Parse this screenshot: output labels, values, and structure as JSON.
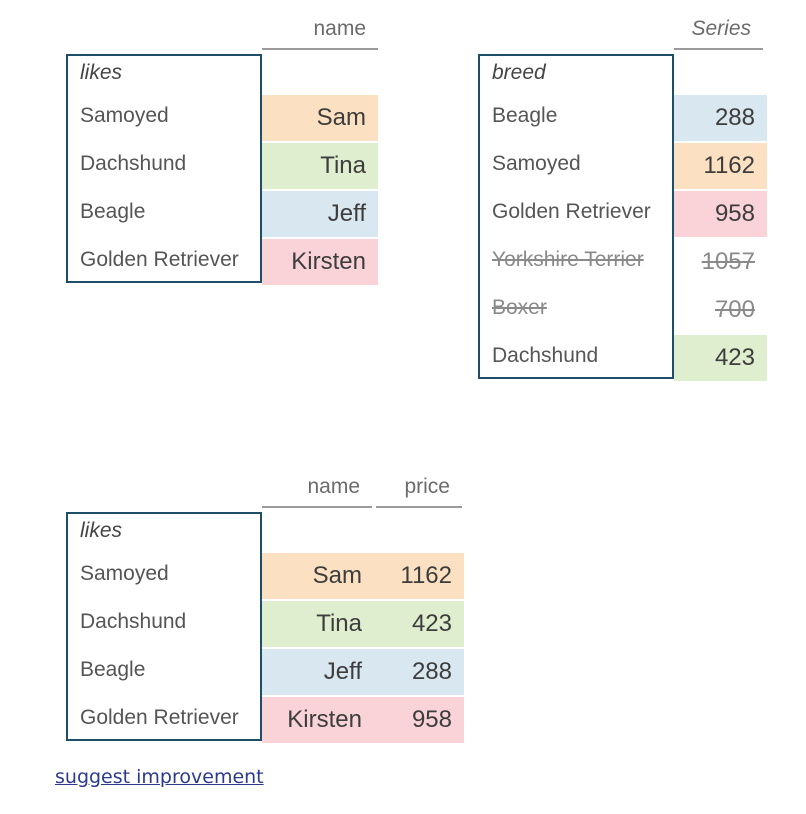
{
  "page": {
    "background": "#ffffff",
    "index_box_border_color": "#1f4e69",
    "header_rule_color": "#9a9a9a",
    "text_color": "#555555",
    "muted_text_color": "#8a8a8a",
    "link_color": "#2b3a8f"
  },
  "palette": {
    "orange": "#fce0c2",
    "green": "#dfeecf",
    "blue": "#d8e7f0",
    "pink": "#f9d3d8",
    "none": "#ffffff"
  },
  "left_table": {
    "name": "likes-dataframe",
    "index_header": "likes",
    "columns": [
      "name"
    ],
    "rows": [
      {
        "index": "Samoyed",
        "name": "Sam",
        "color": "orange",
        "struck": false
      },
      {
        "index": "Dachshund",
        "name": "Tina",
        "color": "green",
        "struck": false
      },
      {
        "index": "Beagle",
        "name": "Jeff",
        "color": "blue",
        "struck": false
      },
      {
        "index": "Golden Retriever",
        "name": "Kirsten",
        "color": "pink",
        "struck": false
      }
    ]
  },
  "right_table": {
    "name": "breed-series",
    "index_header": "breed",
    "series_header": "Series",
    "columns": [
      "Series"
    ],
    "rows": [
      {
        "index": "Beagle",
        "value": "288",
        "color": "blue",
        "struck": false
      },
      {
        "index": "Samoyed",
        "value": "1162",
        "color": "orange",
        "struck": false
      },
      {
        "index": "Golden Retriever",
        "value": "958",
        "color": "pink",
        "struck": false
      },
      {
        "index": "Yorkshire Terrier",
        "value": "1057",
        "color": "none",
        "struck": true
      },
      {
        "index": "Boxer",
        "value": "700",
        "color": "none",
        "struck": true
      },
      {
        "index": "Dachshund",
        "value": "423",
        "color": "green",
        "struck": false
      }
    ]
  },
  "result_table": {
    "name": "result-dataframe",
    "index_header": "likes",
    "columns": [
      "name",
      "price"
    ],
    "rows": [
      {
        "index": "Samoyed",
        "name": "Sam",
        "price": "1162",
        "color": "orange",
        "struck": false
      },
      {
        "index": "Dachshund",
        "name": "Tina",
        "price": "423",
        "color": "green",
        "struck": false
      },
      {
        "index": "Beagle",
        "name": "Jeff",
        "price": "288",
        "color": "blue",
        "struck": false
      },
      {
        "index": "Golden Retriever",
        "name": "Kirsten",
        "price": "958",
        "color": "pink",
        "struck": false
      }
    ]
  },
  "footer": {
    "link_label": "suggest improvement"
  }
}
